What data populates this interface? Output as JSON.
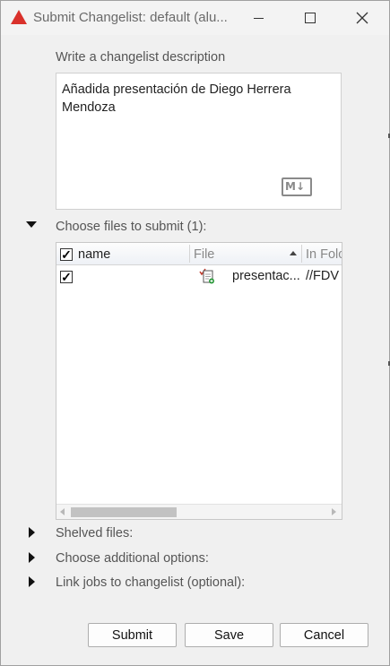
{
  "window": {
    "title": "Submit Changelist: default (alu...",
    "accent_color": "#d9312b"
  },
  "description": {
    "label": "Write a changelist description",
    "text": "Añadida presentación de Diego Herrera Mendoza",
    "markdown_badge": "M↓"
  },
  "files_section": {
    "label": "Choose files to submit (1):",
    "expanded": true,
    "columns": [
      {
        "label": "name"
      },
      {
        "label": "File"
      },
      {
        "label": "In Folc"
      }
    ],
    "rows": [
      {
        "checked": "✓",
        "file": "presentac...",
        "folder": "//FDV"
      }
    ],
    "header_check": "✓"
  },
  "collapsed_sections": [
    {
      "label": "Shelved files:"
    },
    {
      "label": "Choose additional options:"
    },
    {
      "label": "Link jobs to changelist (optional):"
    }
  ],
  "buttons": {
    "submit": "Submit",
    "save": "Save",
    "cancel": "Cancel"
  }
}
